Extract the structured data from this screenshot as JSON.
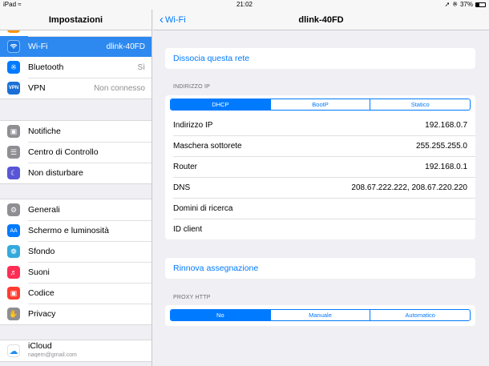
{
  "status_bar": {
    "carrier": "iPad",
    "time": "21:02",
    "battery": "37%",
    "battery_level": 0.37
  },
  "sidebar": {
    "title": "Impostazioni",
    "groups": [
      [
        {
          "label": "Wi-Fi",
          "value": "dlink-40FD",
          "icon": "wifi-icon",
          "color": "#2d89ef"
        },
        {
          "label": "Bluetooth",
          "value": "Sì",
          "icon": "bluetooth-icon",
          "color": "#007aff"
        },
        {
          "label": "VPN",
          "value": "Non connesso",
          "icon": "vpn-icon",
          "color": "#1b6fd6"
        }
      ],
      [
        {
          "label": "Notifiche",
          "value": "",
          "icon": "notifications-icon",
          "color": "#8e8e93"
        },
        {
          "label": "Centro di Controllo",
          "value": "",
          "icon": "control-center-icon",
          "color": "#8e8e93"
        },
        {
          "label": "Non disturbare",
          "value": "",
          "icon": "moon-icon",
          "color": "#5856d6"
        }
      ],
      [
        {
          "label": "Generali",
          "value": "",
          "icon": "gear-icon",
          "color": "#8e8e93"
        },
        {
          "label": "Schermo e luminosità",
          "value": "",
          "icon": "brightness-icon",
          "color": "#007aff"
        },
        {
          "label": "Sfondo",
          "value": "",
          "icon": "wallpaper-icon",
          "color": "#34aadc"
        },
        {
          "label": "Suoni",
          "value": "",
          "icon": "sound-icon",
          "color": "#ff2d55"
        },
        {
          "label": "Codice",
          "value": "",
          "icon": "lock-icon",
          "color": "#ff3b30"
        },
        {
          "label": "Privacy",
          "value": "",
          "icon": "hand-icon",
          "color": "#8e8e93"
        }
      ],
      [
        {
          "label": "iCloud",
          "sub": "naqern@gmail.com",
          "icon": "cloud-icon",
          "color": "#ffffff"
        }
      ]
    ]
  },
  "main": {
    "back_label": "Wi-Fi",
    "title": "dlink-40FD",
    "forget_network": "Dissocia questa rete",
    "ip_section_label": "INDIRIZZO IP",
    "ip_modes": [
      "DHCP",
      "BootP",
      "Statico"
    ],
    "ip_mode_selected": "DHCP",
    "rows": [
      {
        "label": "Indirizzo IP",
        "value": "192.168.0.7"
      },
      {
        "label": "Maschera sottorete",
        "value": "255.255.255.0"
      },
      {
        "label": "Router",
        "value": "192.168.0.1"
      },
      {
        "label": "DNS",
        "value": "208.67.222.222, 208.67.220.220"
      },
      {
        "label": "Domini di ricerca",
        "value": ""
      },
      {
        "label": "ID client",
        "value": ""
      }
    ],
    "renew_lease": "Rinnova assegnazione",
    "proxy_section_label": "PROXY HTTP",
    "proxy_modes": [
      "No",
      "Manuale",
      "Automatico"
    ],
    "proxy_mode_selected": "No"
  }
}
